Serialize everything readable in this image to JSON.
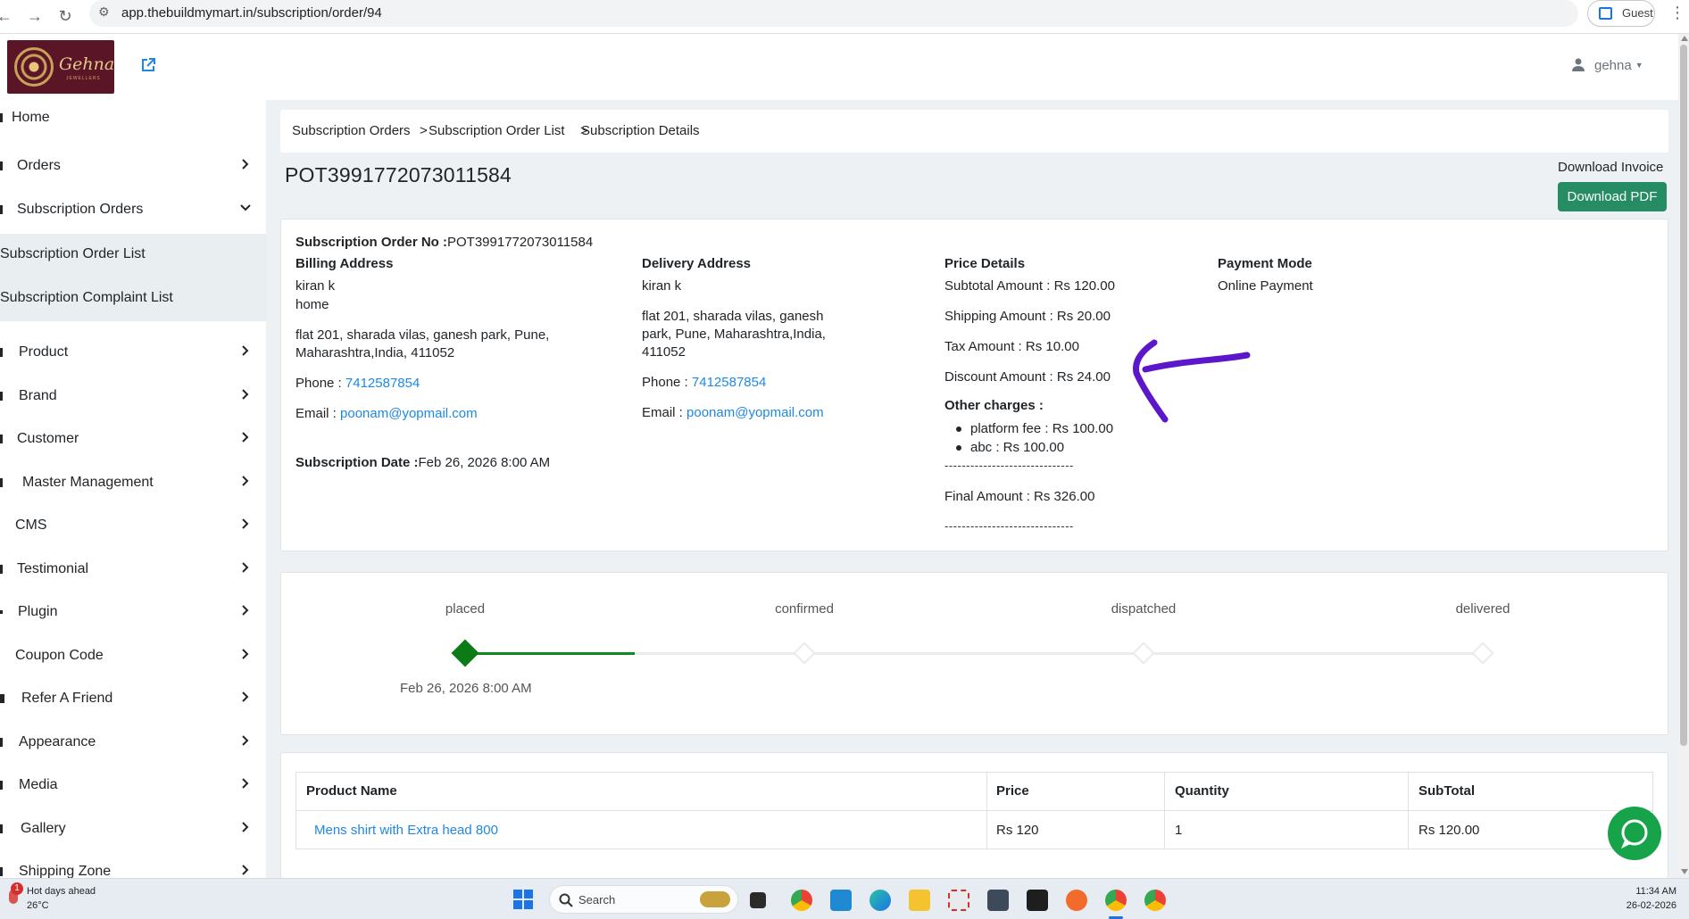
{
  "browser": {
    "url": "app.thebuildmymart.in/subscription/order/94",
    "profile_label": "Guest"
  },
  "header": {
    "logo_text": "Gehna",
    "logo_subtext": "JEWELLERS",
    "user_name": "gehna"
  },
  "sidebar": {
    "items": [
      {
        "label": "Home"
      },
      {
        "label": "Orders"
      },
      {
        "label": "Subscription Orders"
      },
      {
        "label": "Subscription Order List"
      },
      {
        "label": "Subscription Complaint List"
      },
      {
        "label": "Product"
      },
      {
        "label": "Brand"
      },
      {
        "label": "Customer"
      },
      {
        "label": "Master Management"
      },
      {
        "label": "CMS"
      },
      {
        "label": "Testimonial"
      },
      {
        "label": "Plugin"
      },
      {
        "label": "Coupon Code"
      },
      {
        "label": "Refer A Friend"
      },
      {
        "label": "Appearance"
      },
      {
        "label": "Media"
      },
      {
        "label": "Gallery"
      },
      {
        "label": "Shipping Zone"
      }
    ]
  },
  "breadcrumb": {
    "level1": "Subscription Orders",
    "sep1": ">",
    "level2": "Subscription Order List",
    "sep2": ">",
    "level3": "Subscription Details"
  },
  "page": {
    "title": "POT3991772073011584",
    "download_label": "Download Invoice",
    "download_button": "Download PDF"
  },
  "order": {
    "order_no_label": "Subscription Order No :",
    "order_no": "POT3991772073011584",
    "billing": {
      "heading": "Billing Address",
      "name": "kiran k",
      "type": "home",
      "address_line1": "flat 201, sharada vilas, ganesh park, Pune,",
      "address_line2": "Maharashtra,India, 411052",
      "phone_label": "Phone :",
      "phone": "7412587854",
      "email_label": "Email :",
      "email": "poonam@yopmail.com"
    },
    "delivery": {
      "heading": "Delivery Address",
      "name": "kiran k",
      "address_line1": "flat 201, sharada vilas, ganesh",
      "address_line2": "park, Pune, Maharashtra,India,",
      "address_line3": "411052",
      "phone_label": "Phone :",
      "phone": "7412587854",
      "email_label": "Email :",
      "email": "poonam@yopmail.com"
    },
    "subscription_date_label": "Subscription Date :",
    "subscription_date": "Feb 26, 2026 8:00 AM",
    "price": {
      "heading": "Price Details",
      "subtotal": "Subtotal Amount : Rs 120.00",
      "shipping": "Shipping Amount : Rs 20.00",
      "tax": "Tax Amount : Rs 10.00",
      "discount": "Discount Amount : Rs 24.00",
      "other_heading": "Other charges :",
      "other_charges": [
        "platform fee :  Rs  100.00",
        "abc :  Rs  100.00"
      ],
      "separator": "------------------------------",
      "final": "Final Amount : Rs  326.00"
    },
    "payment": {
      "heading": "Payment Mode",
      "mode": "Online Payment"
    }
  },
  "timeline": {
    "steps": [
      {
        "label": "placed",
        "date": "Feb 26, 2026 8:00 AM"
      },
      {
        "label": "confirmed"
      },
      {
        "label": "dispatched"
      },
      {
        "label": "delivered"
      }
    ],
    "completed_steps": 1
  },
  "table": {
    "headers": [
      "Product Name",
      "Price",
      "Quantity",
      "SubTotal"
    ],
    "rows": [
      [
        "Mens shirt with Extra head 800",
        "Rs 120",
        "1",
        "Rs 120.00"
      ]
    ]
  },
  "taskbar": {
    "weather_title": "Hot days ahead",
    "weather_temp": "26°C",
    "weather_badge": "1",
    "search_placeholder": "Search",
    "time": "11:34 AM",
    "date": "26-02-2026"
  },
  "colors": {
    "primary_green": "#268c64",
    "timeline_green": "#0c7b16",
    "link_blue": "#1e88e5",
    "annotation_purple": "#5b17c9",
    "logo_bg": "#5a1626"
  }
}
